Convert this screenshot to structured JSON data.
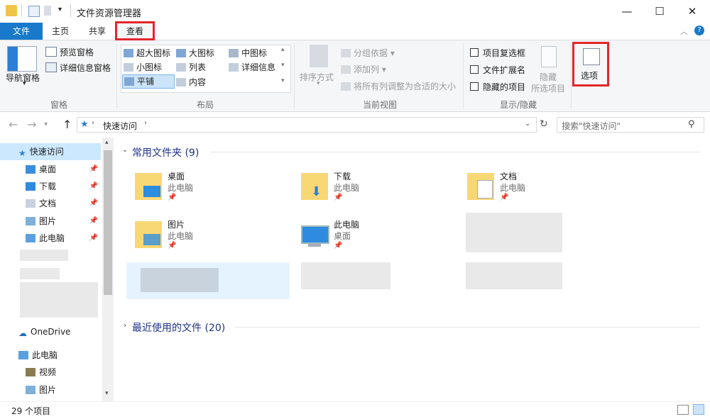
{
  "window": {
    "title": "文件资源管理器"
  },
  "tabs": {
    "file": "文件",
    "home": "主页",
    "share": "共享",
    "view": "查看"
  },
  "ribbon": {
    "pane": {
      "nav_pane": "导航窗格",
      "preview_pane": "预览窗格",
      "details_pane": "详细信息窗格",
      "label": "窗格"
    },
    "layout": {
      "xl_icons": "超大图标",
      "large_icons": "大图标",
      "medium_icons": "中图标",
      "small_icons": "小图标",
      "list": "列表",
      "details": "详细信息",
      "tiles": "平铺",
      "content": "内容",
      "label": "布局"
    },
    "current_view": {
      "sort": "排序方式",
      "group": "分组依据",
      "add_column": "添加列",
      "fit_columns": "将所有列调整为合适的大小",
      "label": "当前视图"
    },
    "show_hide": {
      "item_checkboxes": "项目复选框",
      "file_extensions": "文件扩展名",
      "hidden_items": "隐藏的项目",
      "hide_selected": "隐藏",
      "hide_selected2": "所选项目",
      "label": "显示/隐藏"
    },
    "options": "选项"
  },
  "address": {
    "path": "快速访问",
    "search_placeholder": "搜索\"快速访问\""
  },
  "nav": {
    "quick_access": "快速访问",
    "items": [
      "桌面",
      "下载",
      "文档",
      "图片",
      "此电脑"
    ],
    "onedrive": "OneDrive",
    "this_pc": "此电脑",
    "pc_items": [
      "视频",
      "图片"
    ]
  },
  "main": {
    "frequent_header": "常用文件夹 (9)",
    "recent_header": "最近使用的文件 (20)",
    "folders": [
      {
        "name": "桌面",
        "loc": "此电脑"
      },
      {
        "name": "下载",
        "loc": "此电脑"
      },
      {
        "name": "文档",
        "loc": "此电脑"
      },
      {
        "name": "图片",
        "loc": "此电脑"
      },
      {
        "name": "此电脑",
        "loc": "桌面"
      }
    ]
  },
  "status": {
    "count": "29 个项目"
  },
  "colors": {
    "accent": "#1979ca",
    "highlight": "#e3262b",
    "folder": "#f8d775"
  }
}
